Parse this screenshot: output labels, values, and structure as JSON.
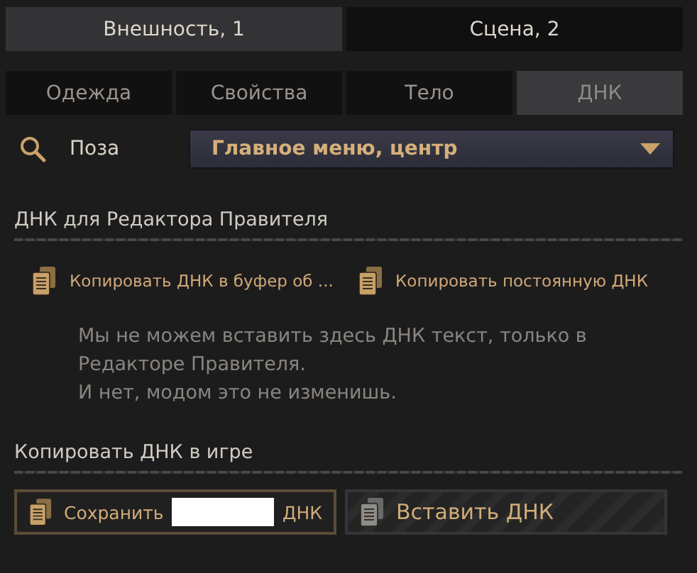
{
  "top_tabs": [
    {
      "label": "Внешность, 1",
      "selected": true
    },
    {
      "label": "Сцена, 2",
      "selected": false
    }
  ],
  "sub_tabs": [
    {
      "label": "Одежда",
      "selected": false
    },
    {
      "label": "Свойства",
      "selected": false
    },
    {
      "label": "Тело",
      "selected": false
    },
    {
      "label": "ДНК",
      "selected": true
    }
  ],
  "pose": {
    "label": "Поза",
    "value": "Главное меню, центр"
  },
  "ruler_section": {
    "title": "ДНК для Редактора Правителя",
    "actions": [
      {
        "label": "Копировать ДНК в буфер об ..."
      },
      {
        "label": "Копировать постоянную ДНК"
      }
    ],
    "message": [
      "Мы не можем вставить здесь ДНК текст, только в",
      "Редакторе Правителя.",
      "И нет, модом это не изменишь."
    ]
  },
  "game_section": {
    "title": "Копировать ДНК в игре",
    "buttons": [
      {
        "label_before": "Сохранить",
        "redacted": true,
        "label_after": "ДНК",
        "disabled": false
      },
      {
        "label_before": "Вставить ДНК",
        "disabled": true
      }
    ]
  }
}
